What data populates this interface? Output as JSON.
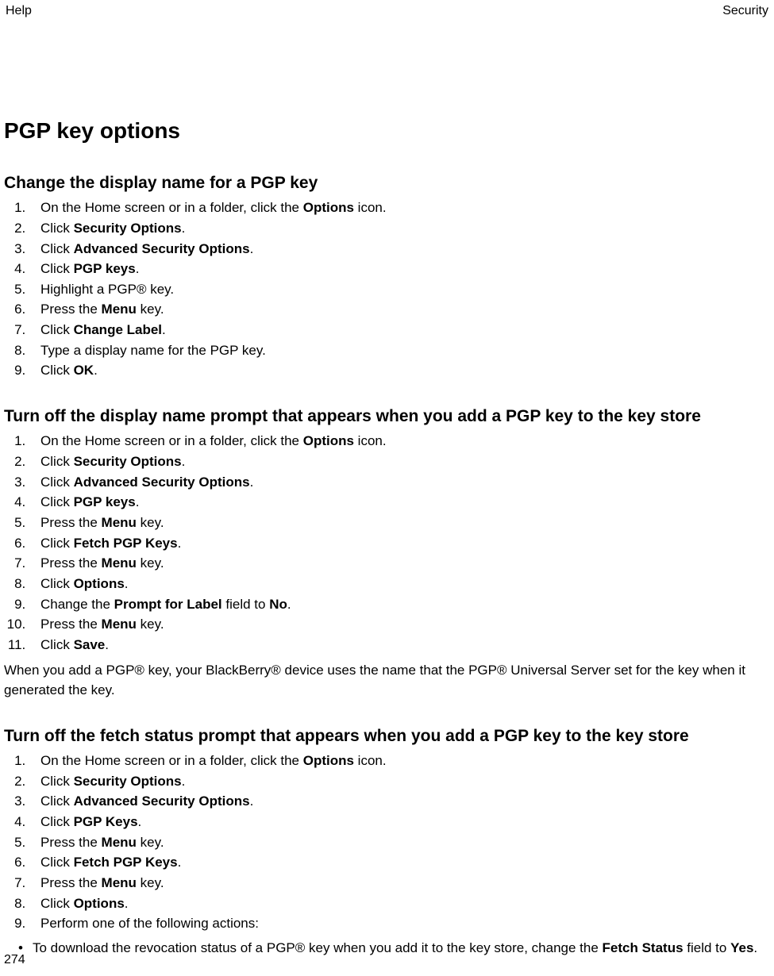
{
  "header": {
    "left": "Help",
    "right": "Security"
  },
  "title": "PGP key options",
  "sections": [
    {
      "heading": "Change the display name for a PGP key",
      "steps": [
        [
          {
            "t": "On the Home screen or in a folder, click the "
          },
          {
            "t": "Options",
            "b": 1
          },
          {
            "t": " icon."
          }
        ],
        [
          {
            "t": "Click "
          },
          {
            "t": "Security Options",
            "b": 1
          },
          {
            "t": "."
          }
        ],
        [
          {
            "t": "Click "
          },
          {
            "t": "Advanced Security Options",
            "b": 1
          },
          {
            "t": "."
          }
        ],
        [
          {
            "t": "Click "
          },
          {
            "t": "PGP keys",
            "b": 1
          },
          {
            "t": "."
          }
        ],
        [
          {
            "t": "Highlight a PGP® key."
          }
        ],
        [
          {
            "t": "Press the "
          },
          {
            "t": "Menu",
            "b": 1
          },
          {
            "t": " key."
          }
        ],
        [
          {
            "t": "Click "
          },
          {
            "t": "Change Label",
            "b": 1
          },
          {
            "t": "."
          }
        ],
        [
          {
            "t": "Type a display name for the PGP key."
          }
        ],
        [
          {
            "t": "Click "
          },
          {
            "t": "OK",
            "b": 1
          },
          {
            "t": "."
          }
        ]
      ]
    },
    {
      "heading": "Turn off the display name prompt that appears when you add a PGP key to the key store",
      "steps": [
        [
          {
            "t": "On the Home screen or in a folder, click the "
          },
          {
            "t": "Options",
            "b": 1
          },
          {
            "t": " icon."
          }
        ],
        [
          {
            "t": "Click "
          },
          {
            "t": "Security Options",
            "b": 1
          },
          {
            "t": "."
          }
        ],
        [
          {
            "t": "Click "
          },
          {
            "t": "Advanced Security Options",
            "b": 1
          },
          {
            "t": "."
          }
        ],
        [
          {
            "t": "Click "
          },
          {
            "t": "PGP keys",
            "b": 1
          },
          {
            "t": "."
          }
        ],
        [
          {
            "t": "Press the "
          },
          {
            "t": "Menu",
            "b": 1
          },
          {
            "t": " key."
          }
        ],
        [
          {
            "t": "Click "
          },
          {
            "t": "Fetch PGP Keys",
            "b": 1
          },
          {
            "t": "."
          }
        ],
        [
          {
            "t": "Press the "
          },
          {
            "t": "Menu",
            "b": 1
          },
          {
            "t": " key."
          }
        ],
        [
          {
            "t": "Click "
          },
          {
            "t": "Options",
            "b": 1
          },
          {
            "t": "."
          }
        ],
        [
          {
            "t": "Change the "
          },
          {
            "t": "Prompt for Label",
            "b": 1
          },
          {
            "t": " field to "
          },
          {
            "t": "No",
            "b": 1
          },
          {
            "t": "."
          }
        ],
        [
          {
            "t": "Press the "
          },
          {
            "t": "Menu",
            "b": 1
          },
          {
            "t": " key."
          }
        ],
        [
          {
            "t": "Click "
          },
          {
            "t": "Save",
            "b": 1
          },
          {
            "t": "."
          }
        ]
      ],
      "tail": [
        {
          "t": "When you add a PGP® key, your BlackBerry® device uses the name that the PGP® Universal Server set for the key when it generated the key."
        }
      ]
    },
    {
      "heading": "Turn off the fetch status prompt that appears when you add a PGP key to the key store",
      "steps": [
        [
          {
            "t": "On the Home screen or in a folder, click the "
          },
          {
            "t": "Options",
            "b": 1
          },
          {
            "t": " icon."
          }
        ],
        [
          {
            "t": "Click "
          },
          {
            "t": "Security Options",
            "b": 1
          },
          {
            "t": "."
          }
        ],
        [
          {
            "t": "Click "
          },
          {
            "t": "Advanced Security Options",
            "b": 1
          },
          {
            "t": "."
          }
        ],
        [
          {
            "t": "Click "
          },
          {
            "t": "PGP Keys",
            "b": 1
          },
          {
            "t": "."
          }
        ],
        [
          {
            "t": "Press the "
          },
          {
            "t": "Menu",
            "b": 1
          },
          {
            "t": " key."
          }
        ],
        [
          {
            "t": "Click "
          },
          {
            "t": "Fetch PGP Keys",
            "b": 1
          },
          {
            "t": "."
          }
        ],
        [
          {
            "t": "Press the "
          },
          {
            "t": "Menu",
            "b": 1
          },
          {
            "t": " key."
          }
        ],
        [
          {
            "t": "Click "
          },
          {
            "t": "Options",
            "b": 1
          },
          {
            "t": "."
          }
        ],
        [
          {
            "t": "Perform one of the following actions:"
          }
        ]
      ],
      "bullets": [
        [
          {
            "t": "To download the revocation status of a PGP® key when you add it to the key store, change the "
          },
          {
            "t": "Fetch Status",
            "b": 1
          },
          {
            "t": " field to "
          },
          {
            "t": "Yes",
            "b": 1
          },
          {
            "t": "."
          }
        ]
      ]
    }
  ],
  "page_number": "274"
}
